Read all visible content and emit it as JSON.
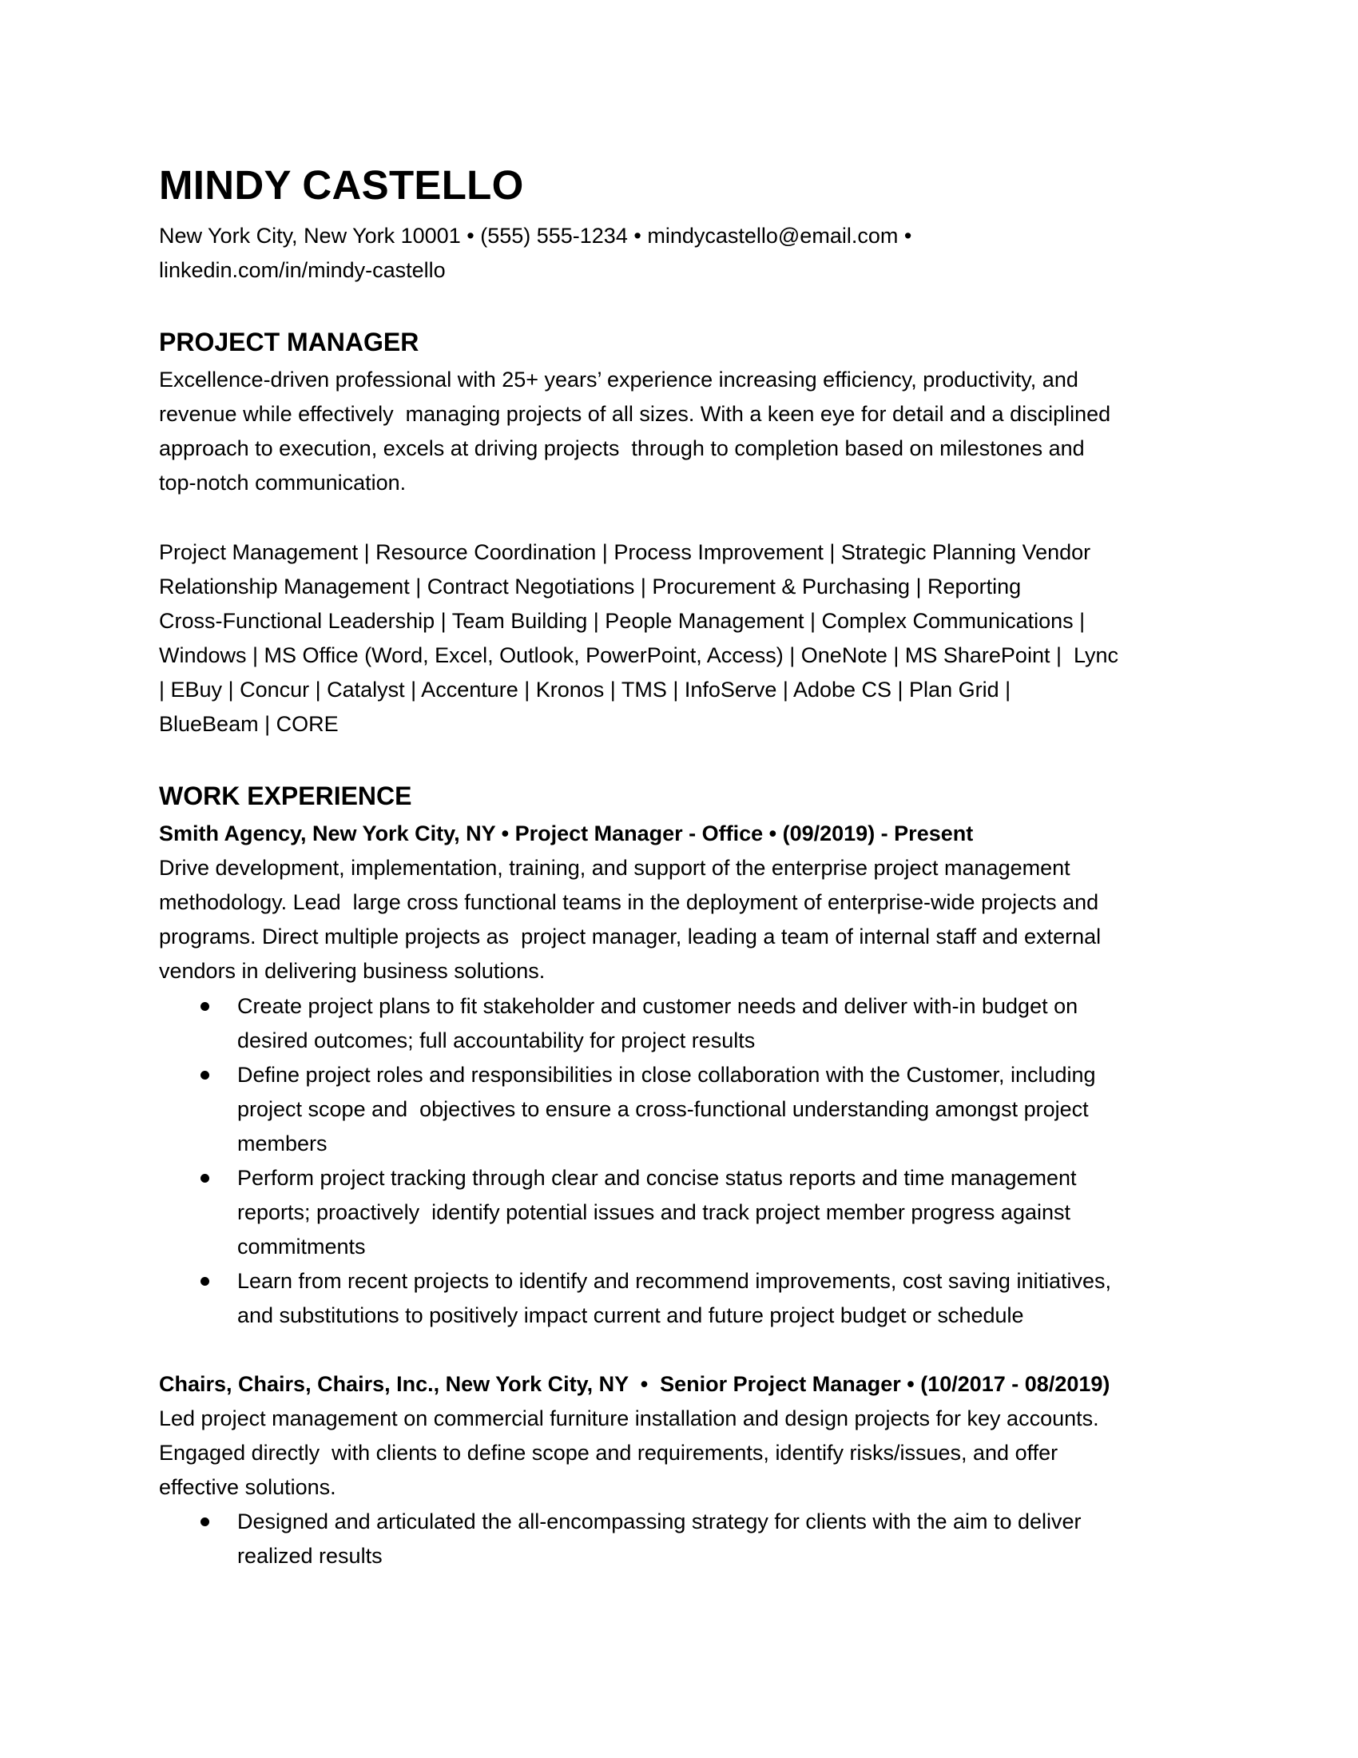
{
  "header": {
    "name": "MINDY CASTELLO",
    "contact": {
      "location": "New York City, New York 10001",
      "phone": "(555) 555-1234",
      "email": "mindycastello@email.com",
      "linkedin": "linkedin.com/in/mindy-castello",
      "separator": "•"
    }
  },
  "summary": {
    "heading": "PROJECT MANAGER",
    "lines": [
      "Excellence-driven professional with 25+ years’ experience increasing efficiency, productivity, and",
      "revenue while effectively  managing projects of all sizes. With a keen eye for detail and a disciplined",
      "approach to execution, excels at driving projects  through to completion based on milestones and",
      "top-notch communication."
    ]
  },
  "skills": {
    "lines": [
      "Project Management | Resource Coordination | Process Improvement | Strategic Planning Vendor",
      "Relationship Management | Contract Negotiations | Procurement & Purchasing | Reporting",
      "Cross-Functional Leadership | Team Building | People Management | Complex Communications |",
      "Windows | MS Office (Word, Excel, Outlook, PowerPoint, Access) | OneNote | MS SharePoint |  Lync",
      "| EBuy | Concur | Catalyst | Accenture | Kronos | TMS | InfoServe | Adobe CS | Plan Grid |",
      "BlueBeam | CORE"
    ]
  },
  "experience": {
    "heading": "WORK EXPERIENCE",
    "jobs": [
      {
        "header": "Smith Agency, New York City, NY • Project Manager - Office • (09/2019) - Present",
        "description_lines": [
          "Drive development, implementation, training, and support of the enterprise project management",
          "methodology. Lead  large cross functional teams in the deployment of enterprise-wide projects and",
          "programs. Direct multiple projects as  project manager, leading a team of internal staff and external",
          "vendors in delivering business solutions."
        ],
        "bullets": [
          {
            "lines": [
              "Create project plans to fit stakeholder and customer needs and deliver with-in budget on",
              "desired outcomes; full accountability for project results"
            ]
          },
          {
            "lines": [
              "Define project roles and responsibilities in close collaboration with the Customer, including",
              "project scope and  objectives to ensure a cross-functional understanding amongst project",
              "members"
            ]
          },
          {
            "lines": [
              "Perform project tracking through clear and concise status reports and time management",
              "reports; proactively  identify potential issues and track project member progress against",
              "commitments"
            ]
          },
          {
            "lines": [
              "Learn from recent projects to identify and recommend improvements, cost saving initiatives,",
              "and substitutions to positively impact current and future project budget or schedule"
            ]
          }
        ]
      },
      {
        "header": "Chairs, Chairs, Chairs, Inc., New York City, NY  •  Senior Project Manager • (10/2017 - 08/2019)",
        "description_lines": [
          "Led project management on commercial furniture installation and design projects for key accounts.",
          "Engaged directly  with clients to define scope and requirements, identify risks/issues, and offer",
          "effective solutions."
        ],
        "bullets": [
          {
            "lines": [
              "Designed and articulated the all-encompassing strategy for clients with the aim to deliver",
              "realized results"
            ]
          }
        ]
      }
    ]
  }
}
